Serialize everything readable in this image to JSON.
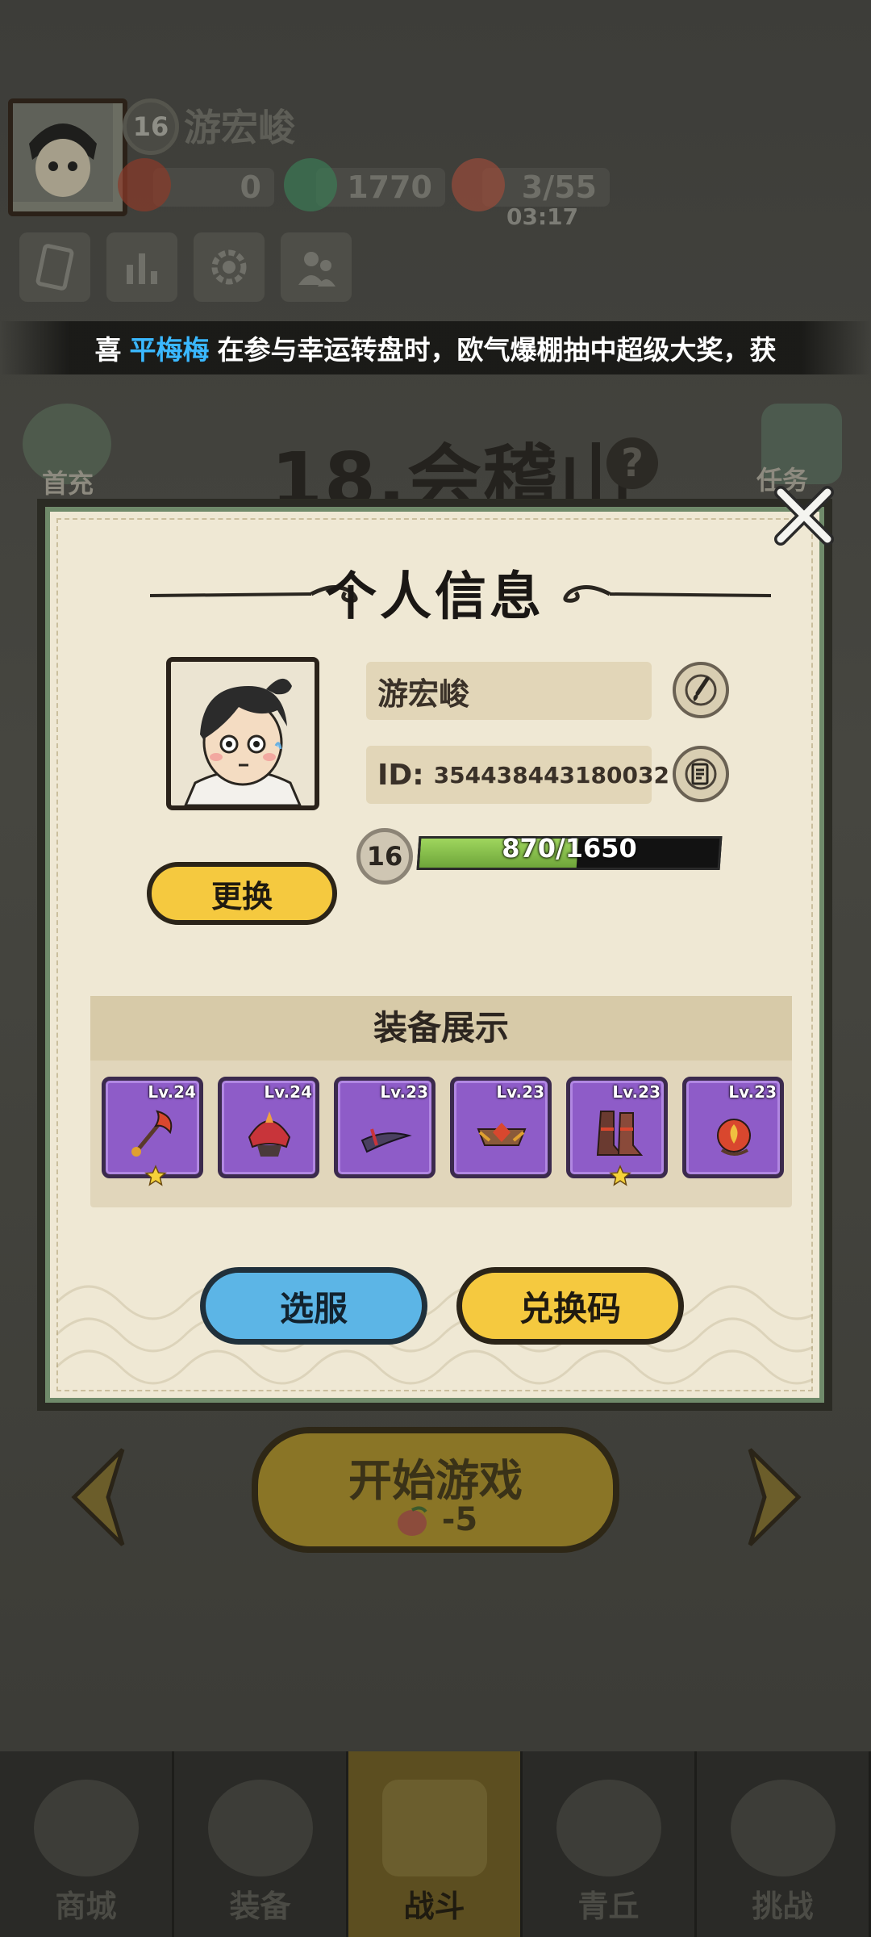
{
  "hud": {
    "player_name": "游宏峻",
    "level": "16",
    "resource_a": "0",
    "resource_b": "1770",
    "stamina": "3/55",
    "stamina_timer": "03:17"
  },
  "ticker": {
    "prefix": "喜",
    "highlight_name": "平梅梅",
    "message": "在参与幸运转盘时，欧气爆棚抽中超级大奖，获"
  },
  "stage": {
    "title": "18.会稽山",
    "help": "?",
    "left_side_label": "首充",
    "right_side_label": "任务"
  },
  "start": {
    "label": "开始游戏",
    "cost": "-5"
  },
  "bottom_nav": [
    {
      "label": "商城"
    },
    {
      "label": "装备"
    },
    {
      "label": "战斗"
    },
    {
      "label": "青丘"
    },
    {
      "label": "挑战"
    }
  ],
  "profile": {
    "title": "个人信息",
    "name": "游宏峻",
    "id_prefix": "ID:",
    "id_value": "354438443180032",
    "level": "16",
    "xp_text": "870/1650",
    "xp_progress": 0.527,
    "change_label": "更换",
    "equip_title": "装备展示",
    "equipment": [
      {
        "level": "Lv.24",
        "starred": true,
        "color": "#d9472e"
      },
      {
        "level": "Lv.24",
        "starred": false,
        "color": "#c8343a"
      },
      {
        "level": "Lv.23",
        "starred": false,
        "color": "#6a5a80"
      },
      {
        "level": "Lv.23",
        "starred": false,
        "color": "#d98a3a"
      },
      {
        "level": "Lv.23",
        "starred": true,
        "color": "#8a4a3a"
      },
      {
        "level": "Lv.23",
        "starred": false,
        "color": "#d9472e"
      }
    ],
    "server_label": "选服",
    "code_label": "兑换码"
  },
  "colors": {
    "equip_slot": "#8e5cc8",
    "ticker_highlight": "#3ab8ff",
    "button_yellow": "#f5c93f",
    "button_blue": "#5cb5e6",
    "xp_green": "#8ac84e"
  }
}
